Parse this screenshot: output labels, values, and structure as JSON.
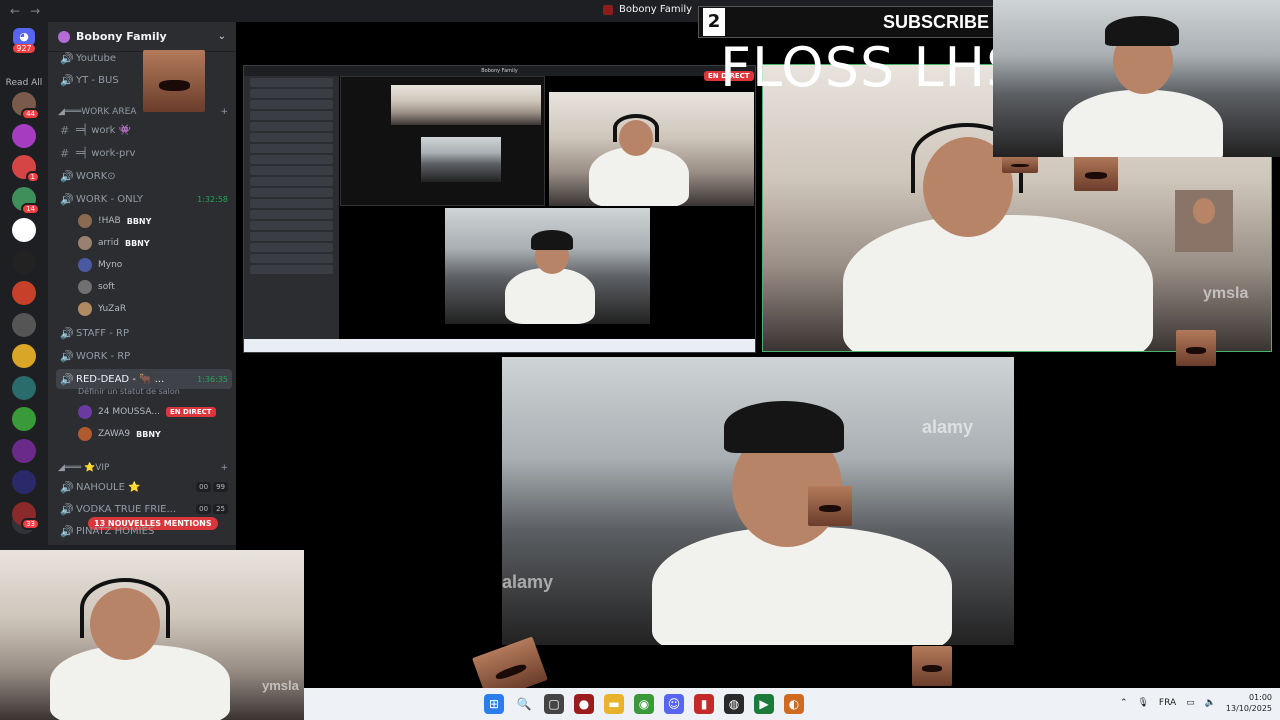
{
  "window": {
    "title": "Bobony Family"
  },
  "rail": {
    "dm_badge": "927",
    "read_all": "Read All",
    "servers": [
      {
        "color": "#7a5a4a",
        "badge": "44"
      },
      {
        "color": "#a63cc0",
        "badge": ""
      },
      {
        "color": "#d64545",
        "badge": "1"
      },
      {
        "color": "#3f8f5a",
        "badge": "14"
      },
      {
        "color": "#ffffff",
        "badge": ""
      },
      {
        "color": "#222222",
        "badge": ""
      },
      {
        "color": "#c7402a",
        "badge": ""
      },
      {
        "color": "#555555",
        "badge": ""
      },
      {
        "color": "#d9a628",
        "badge": ""
      },
      {
        "color": "#2a6b6b",
        "badge": ""
      },
      {
        "color": "#3a9a3a",
        "badge": ""
      },
      {
        "color": "#6a2a8a",
        "badge": ""
      },
      {
        "color": "#2a2a6a",
        "badge": ""
      },
      {
        "color": "#8a2a2a",
        "badge": "33"
      }
    ]
  },
  "sidebar": {
    "server_name": "Bobony Family",
    "channels": [
      {
        "label": "Youtube",
        "glyph": "🔊",
        "time": ""
      },
      {
        "label": "YT - BUS",
        "glyph": "🔊",
        "time": ""
      }
    ],
    "work_area": "WORK AREA",
    "work_channels": [
      {
        "label": "═╡ work 👾",
        "glyph": "#"
      },
      {
        "label": "═╡ work-prv",
        "glyph": "#"
      },
      {
        "label": "WORK⊙",
        "glyph": "🔊"
      },
      {
        "label": "WORK - ONLY",
        "glyph": "🔊",
        "time": "1:32:58"
      }
    ],
    "work_users": [
      {
        "name": "!HAB",
        "tag": "BBNY",
        "color": "#8a6a50"
      },
      {
        "name": "arrid",
        "tag": "BBNY",
        "color": "#9a8070"
      },
      {
        "name": "Myno",
        "tag": "",
        "color": "#4a5aa0"
      },
      {
        "name": "soft",
        "tag": "",
        "color": "#707070"
      },
      {
        "name": "YuZaR",
        "tag": "",
        "color": "#b08a60"
      }
    ],
    "more_channels": [
      {
        "label": "STAFF - RP"
      },
      {
        "label": "WORK - RP"
      }
    ],
    "red_dead": {
      "label": "RED-DEAD - 🐂 ...",
      "time": "1:36:35",
      "status": "Définir un statut de salon"
    },
    "red_users": [
      {
        "name": "24 MOUSSA...",
        "live": "EN DIRECT",
        "color": "#6a3aa0"
      },
      {
        "name": "ZAWA9",
        "tag": "BBNY",
        "color": "#b05a30"
      }
    ],
    "vip": "VIP",
    "vip_channels": [
      {
        "label": "NAHOULE ⭐",
        "a": "00",
        "b": "99"
      },
      {
        "label": "VODKA TRUE FRIE...",
        "a": "00",
        "b": "25"
      },
      {
        "label": "PINATZ HOMIES",
        "a": "",
        "b": ""
      }
    ],
    "mentions": "13 NOUVELLES MENTIONS"
  },
  "overlay": {
    "subscribe_num": "2",
    "subscribe_text": "SUBSCRIBE",
    "floss": "FLOSS LHS",
    "live": "EN DIRECT",
    "watermark": "alamy",
    "watermark2": "ymsla"
  },
  "taskbar": {
    "lang": "FRA",
    "time": "01:00",
    "date": "13/10/2025",
    "apps": [
      {
        "name": "windows-icon",
        "color": "#2b7de9",
        "glyph": "⊞"
      },
      {
        "name": "search-icon",
        "color": "#eef2f6",
        "glyph": "🔍"
      },
      {
        "name": "taskview-icon",
        "color": "#444",
        "glyph": "▢"
      },
      {
        "name": "app-icon",
        "color": "#9b1c1c",
        "glyph": "●"
      },
      {
        "name": "explorer-icon",
        "color": "#e8b32a",
        "glyph": "▬"
      },
      {
        "name": "chrome-icon",
        "color": "#3a9a3a",
        "glyph": "◉"
      },
      {
        "name": "discord-icon",
        "color": "#5865f2",
        "glyph": "☺"
      },
      {
        "name": "app-red-icon",
        "color": "#c32a2a",
        "glyph": "▮"
      },
      {
        "name": "obs-icon",
        "color": "#2a2a2a",
        "glyph": "◍"
      },
      {
        "name": "terminal-icon",
        "color": "#1e7a3a",
        "glyph": "▶"
      },
      {
        "name": "stream-icon",
        "color": "#d06a20",
        "glyph": "◐"
      }
    ]
  }
}
